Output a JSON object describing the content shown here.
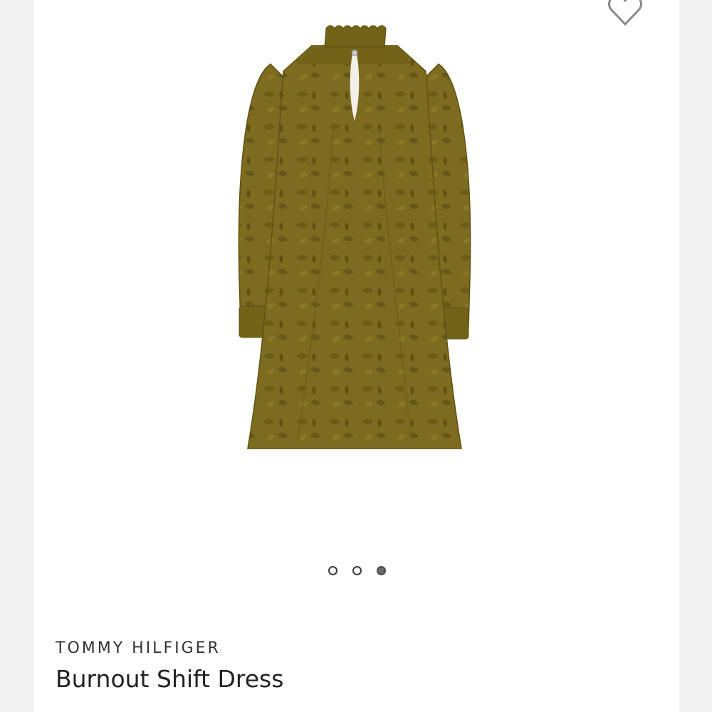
{
  "product": {
    "brand": "TOMMY HILFIGER",
    "name": "Burnout Shift Dress",
    "image": {
      "description": "olive burnout floral long-sleeve shift dress with ruffled mock neck and keyhole",
      "color": "#7a6a1e"
    }
  },
  "gallery": {
    "dots": [
      {
        "active": false
      },
      {
        "active": false
      },
      {
        "active": true
      }
    ]
  },
  "favorite": {
    "icon": "heart-outline-icon"
  },
  "colors": {
    "dress": "#7d6c1f",
    "dress_shadow": "#5f5114",
    "dress_highlight": "#93812c",
    "text_primary": "#222222",
    "text_brand": "#333333"
  }
}
